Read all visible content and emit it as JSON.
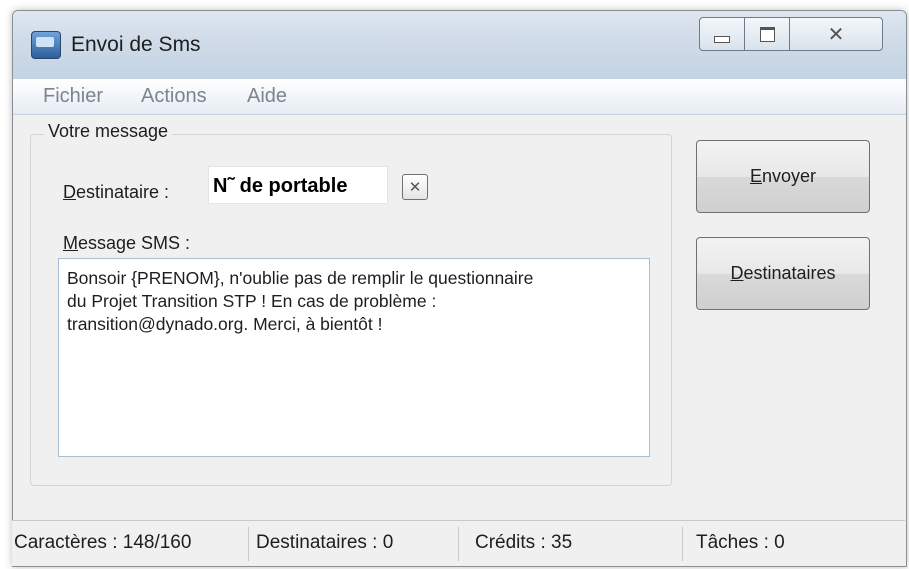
{
  "window": {
    "title": "Envoi de Sms"
  },
  "menu": {
    "items": [
      "Fichier",
      "Actions",
      "Aide"
    ]
  },
  "group": {
    "title": "Votre message"
  },
  "destinataire": {
    "label_first": "D",
    "label_rest": "estinataire :",
    "value": "N˜ de portable",
    "clear_symbol": "✕"
  },
  "message": {
    "label_first": "M",
    "label_rest": "essage SMS :",
    "text": "Bonsoir {PRENOM}, n'oublie pas de remplir le questionnaire\ndu Projet Transition STP ! En cas de problème :\ntransition@dynado.org. Merci, à bientôt !"
  },
  "buttons": {
    "envoyer_first": "E",
    "envoyer_rest": "nvoyer",
    "destinataires_first": "D",
    "destinataires_rest": "estinataires"
  },
  "status": {
    "caracteres": "Caractères : 148/160",
    "destinataires": "Destinataires : 0",
    "credits": "Crédits : 35",
    "taches": "Tâches : 0"
  }
}
